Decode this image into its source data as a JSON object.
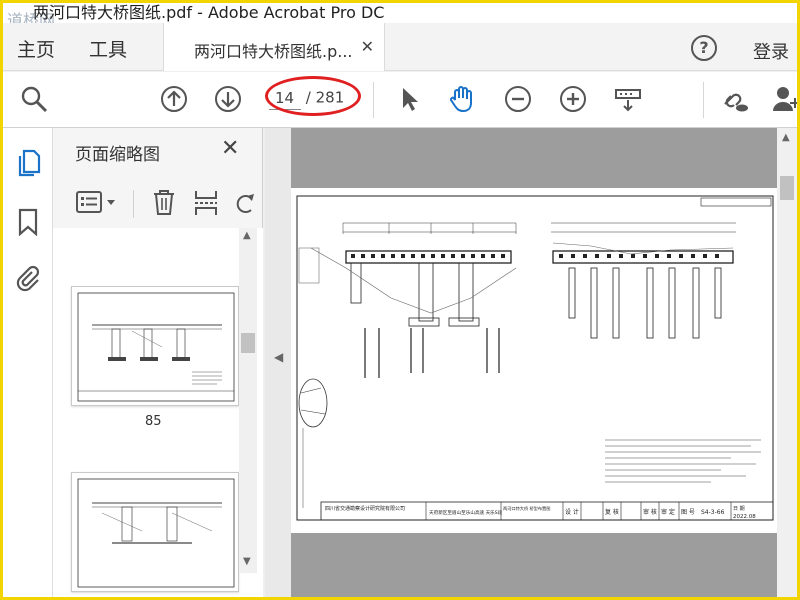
{
  "window": {
    "title": "两河口特大桥图纸.pdf - Adobe Acrobat Pro DC",
    "watermark": "道桥网"
  },
  "tabs": {
    "home": "主页",
    "tools": "工具",
    "document": "两河口特大桥图纸.p...",
    "login": "登录"
  },
  "toolbar": {
    "page_current": "14",
    "page_total": "/ 281"
  },
  "thumbnails": {
    "panel_title": "页面缩略图",
    "pages": [
      "85"
    ]
  },
  "drawing": {
    "title_block_company": "四川省交通勘察设计研究院有限公司",
    "title_block_project": "天府新区至眉山至乐山高速 天乐S段",
    "title_block_name": "两河口特大桥 桥型布置图",
    "sheet_no_label": "图 号",
    "sheet_no": "S4-3-66",
    "date_label": "日 期",
    "date": "2022.08",
    "roles": [
      "设 计",
      "复 核",
      "审 核",
      "审 定"
    ]
  },
  "colors": {
    "annotation": "#e02020",
    "frame_border": "#f2d400",
    "rail_active": "#1a73c9"
  }
}
